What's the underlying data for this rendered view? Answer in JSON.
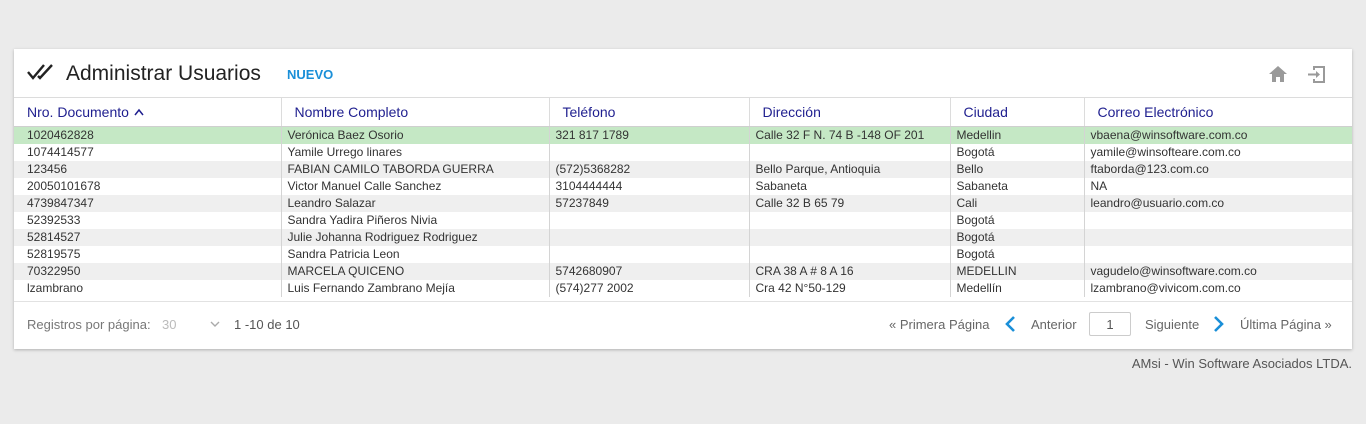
{
  "header": {
    "title": "Administrar Usuarios",
    "new_button": "NUEVO",
    "icons": [
      "double-check-icon",
      "home-icon",
      "exit-icon"
    ]
  },
  "table": {
    "columns": [
      "Nro. Documento",
      "Nombre Completo",
      "Teléfono",
      "Dirección",
      "Ciudad",
      "Correo Electrónico"
    ],
    "sort_column": "Nro. Documento",
    "sort_direction": "asc",
    "rows": [
      {
        "doc": "1020462828",
        "name": "Verónica Baez Osorio",
        "phone": "321 817 1789",
        "address": "Calle 32 F N. 74 B -148 OF 201",
        "city": "Medellin",
        "email": "vbaena@winsoftware.com.co"
      },
      {
        "doc": "1074414577",
        "name": "Yamile Urrego linares",
        "phone": "",
        "address": "",
        "city": "Bogotá",
        "email": "yamile@winsofteare.com.co"
      },
      {
        "doc": "123456",
        "name": "FABIAN CAMILO TABORDA GUERRA",
        "phone": "(572)5368282",
        "address": "Bello Parque, Antioquia",
        "city": "Bello",
        "email": "ftaborda@123.com.co"
      },
      {
        "doc": "20050101678",
        "name": "Victor Manuel Calle Sanchez",
        "phone": "3104444444",
        "address": "Sabaneta",
        "city": "Sabaneta",
        "email": "NA"
      },
      {
        "doc": "4739847347",
        "name": "Leandro Salazar",
        "phone": "57237849",
        "address": "Calle 32 B 65 79",
        "city": "Cali",
        "email": "leandro@usuario.com.co"
      },
      {
        "doc": "52392533",
        "name": "Sandra Yadira Piñeros Nivia",
        "phone": "",
        "address": "",
        "city": "Bogotá",
        "email": ""
      },
      {
        "doc": "52814527",
        "name": "Julie Johanna Rodriguez Rodriguez",
        "phone": "",
        "address": "",
        "city": "Bogotá",
        "email": ""
      },
      {
        "doc": "52819575",
        "name": "Sandra Patricia Leon",
        "phone": "",
        "address": "",
        "city": "Bogotá",
        "email": ""
      },
      {
        "doc": "70322950",
        "name": "MARCELA QUICENO",
        "phone": "5742680907",
        "address": "CRA 38 A # 8 A 16",
        "city": "MEDELLIN",
        "email": "vagudelo@winsoftware.com.co"
      },
      {
        "doc": "lzambrano",
        "name": "Luis Fernando Zambrano Mejía",
        "phone": "(574)277 2002",
        "address": "Cra 42 N°50-129",
        "city": "Medellín",
        "email": "lzambrano@vivicom.com.co"
      }
    ]
  },
  "footer": {
    "per_page_label": "Registros por página:",
    "per_page_value": "30",
    "range": "1 -10 de 10",
    "first_page": "« Primera Página",
    "previous": "Anterior",
    "current_page": "1",
    "next": "Siguiente",
    "last_page": "Última Página »"
  },
  "credit": "AMsi - Win Software Asociados LTDA.",
  "colors": {
    "accent": "#1a8fd8",
    "header_text": "#1f1f8f",
    "selected_row": "#c5e8c5",
    "striped_row": "#efefef"
  }
}
